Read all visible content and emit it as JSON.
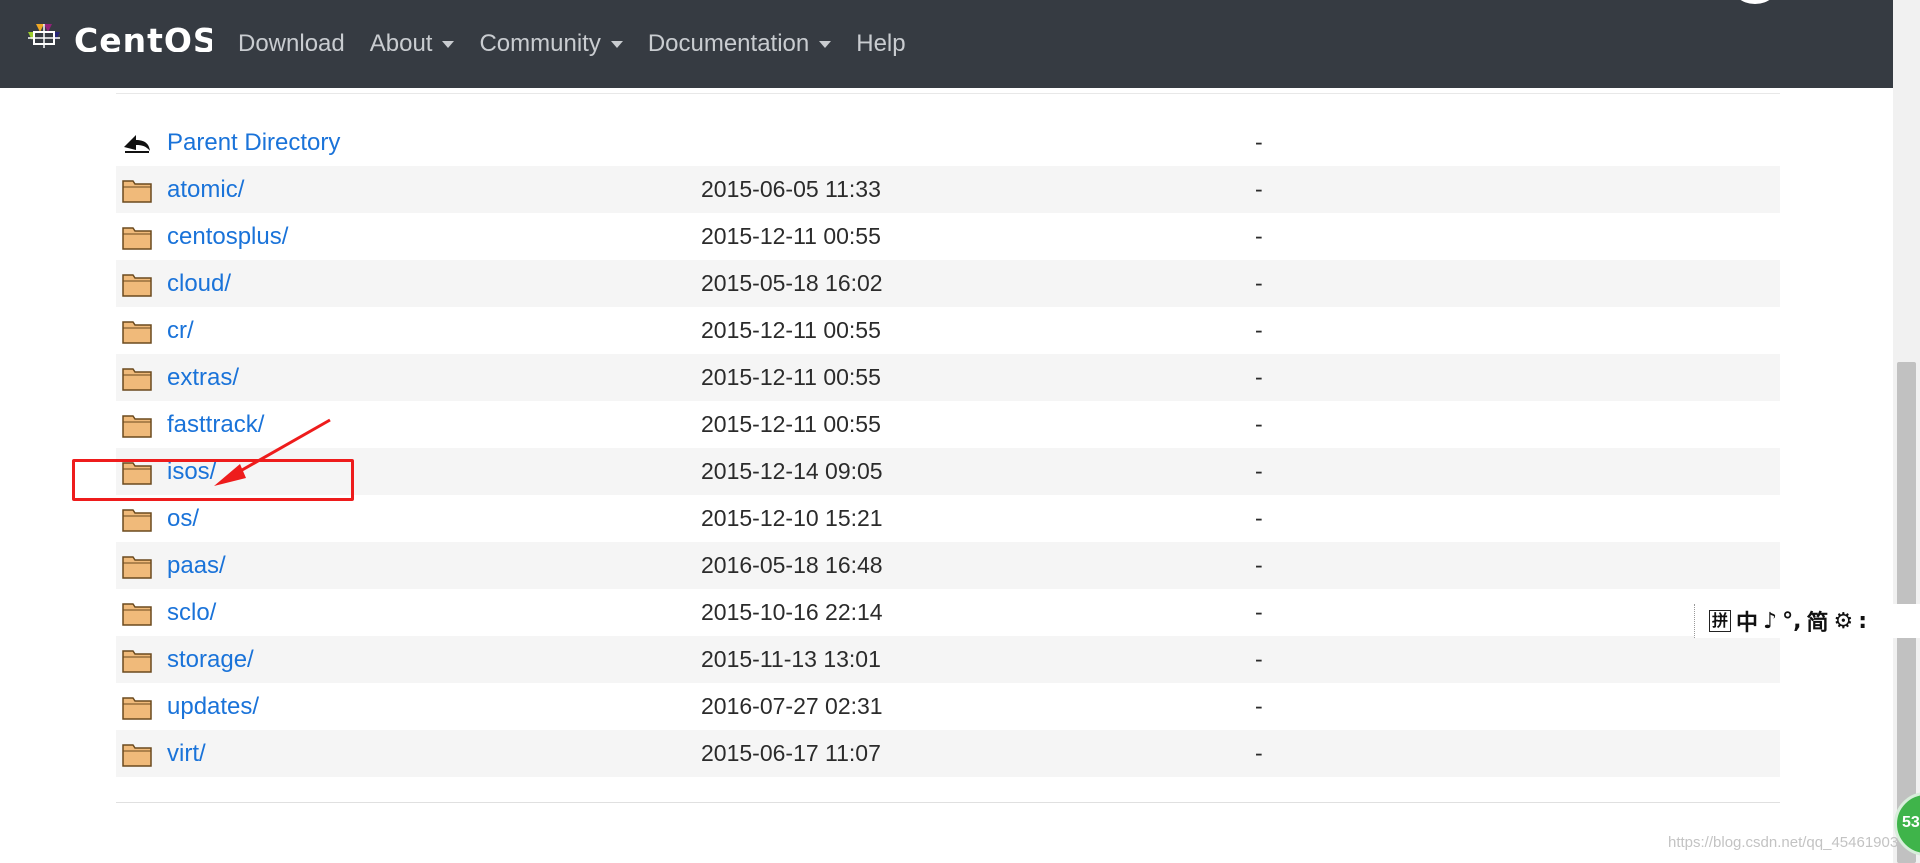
{
  "navbar": {
    "brand": "CentOS",
    "links": [
      {
        "label": "Download",
        "dropdown": false
      },
      {
        "label": "About",
        "dropdown": true
      },
      {
        "label": "Community",
        "dropdown": true
      },
      {
        "label": "Documentation",
        "dropdown": true
      },
      {
        "label": "Help",
        "dropdown": false
      }
    ]
  },
  "listing": {
    "rows": [
      {
        "name": "Parent Directory",
        "date": "",
        "size": "-",
        "icon": "back-arrow-icon"
      },
      {
        "name": "atomic/",
        "date": "2015-06-05 11:33",
        "size": "-",
        "icon": "folder-icon"
      },
      {
        "name": "centosplus/",
        "date": "2015-12-11 00:55",
        "size": "-",
        "icon": "folder-icon"
      },
      {
        "name": "cloud/",
        "date": "2015-05-18 16:02",
        "size": "-",
        "icon": "folder-icon"
      },
      {
        "name": "cr/",
        "date": "2015-12-11 00:55",
        "size": "-",
        "icon": "folder-icon"
      },
      {
        "name": "extras/",
        "date": "2015-12-11 00:55",
        "size": "-",
        "icon": "folder-icon"
      },
      {
        "name": "fasttrack/",
        "date": "2015-12-11 00:55",
        "size": "-",
        "icon": "folder-icon"
      },
      {
        "name": "isos/",
        "date": "2015-12-14 09:05",
        "size": "-",
        "icon": "folder-icon"
      },
      {
        "name": "os/",
        "date": "2015-12-10 15:21",
        "size": "-",
        "icon": "folder-icon"
      },
      {
        "name": "paas/",
        "date": "2016-05-18 16:48",
        "size": "-",
        "icon": "folder-icon"
      },
      {
        "name": "sclo/",
        "date": "2015-10-16 22:14",
        "size": "-",
        "icon": "folder-icon"
      },
      {
        "name": "storage/",
        "date": "2015-11-13 13:01",
        "size": "-",
        "icon": "folder-icon"
      },
      {
        "name": "updates/",
        "date": "2016-07-27 02:31",
        "size": "-",
        "icon": "folder-icon"
      },
      {
        "name": "virt/",
        "date": "2015-06-17 11:07",
        "size": "-",
        "icon": "folder-icon"
      }
    ]
  },
  "annotation": {
    "highlighted_row": "isos/",
    "color": "#ee1c1c"
  },
  "ime_toolbar": {
    "items": [
      {
        "label": "拼",
        "icon": "pinyin-icon"
      },
      {
        "label": "中",
        "icon": "chinese-mode-icon"
      },
      {
        "label": "♪",
        "icon": "moon-icon"
      },
      {
        "label": "°,",
        "icon": "punctuation-icon"
      },
      {
        "label": "简",
        "icon": "simplified-icon"
      },
      {
        "label": "⚙",
        "icon": "settings-icon"
      },
      {
        "label": ":",
        "icon": "more-icon"
      }
    ]
  },
  "watermark": "https://blog.csdn.net/qq_45461903",
  "badge": "53",
  "colors": {
    "navbar_bg": "#363b42",
    "link": "#1a73d9",
    "row_alt": "#f5f5f5"
  }
}
